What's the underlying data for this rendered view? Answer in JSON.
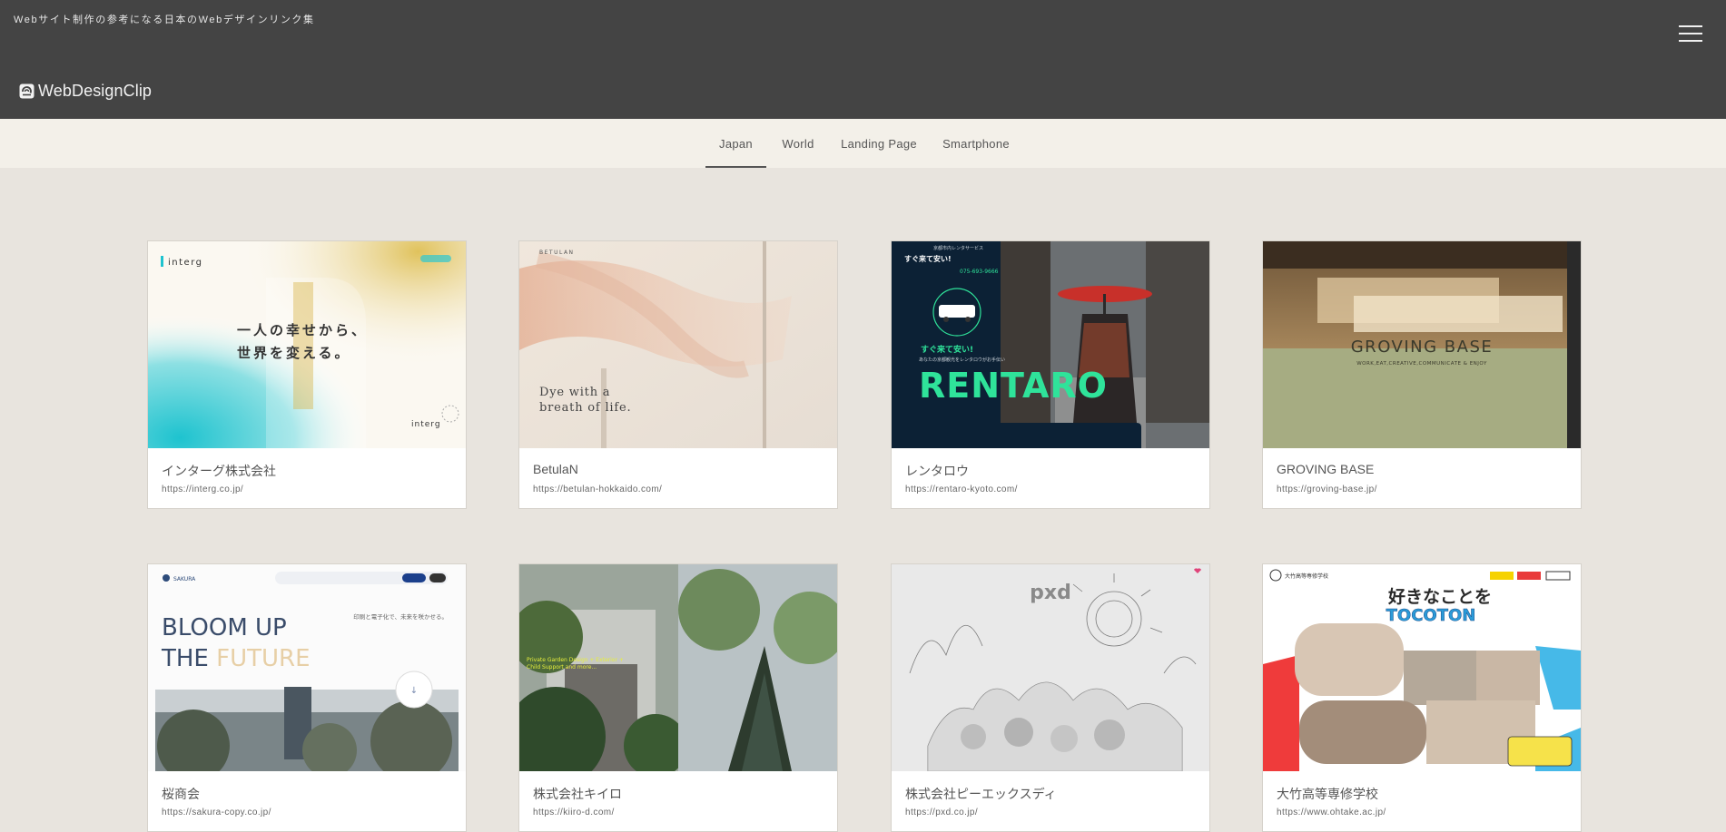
{
  "header": {
    "tagline": "Webサイト制作の参考になる日本のWebデザインリンク集",
    "logo_text": "WebDesignClip",
    "logo_icon": "wdc-logo-icon",
    "menu_icon": "hamburger-icon"
  },
  "nav": {
    "items": [
      {
        "label": "Japan",
        "active": true
      },
      {
        "label": "World",
        "active": false
      },
      {
        "label": "Landing Page",
        "active": false
      },
      {
        "label": "Smartphone",
        "active": false
      }
    ]
  },
  "cards": [
    {
      "title": "インターグ株式会社",
      "url": "https://interg.co.jp/",
      "thumb": {
        "headline1": "一人の幸せから、",
        "headline2": "世界を変える。",
        "brand": "interg"
      }
    },
    {
      "title": "BetulaN",
      "url": "https://betulan-hokkaido.com/",
      "thumb": {
        "line1": "Dye with a",
        "line2": "breath of life.",
        "brand": "BETULAN"
      }
    },
    {
      "title": "レンタロウ",
      "url": "https://rentaro-kyoto.com/",
      "thumb": {
        "catch": "すぐ来て安い!",
        "brand": "RENTARO",
        "phone": "075-693-9666"
      }
    },
    {
      "title": "GROVING BASE",
      "url": "https://groving-base.jp/",
      "thumb": {
        "brand": "GROVING BASE",
        "sub": "WORK,EAT,CREATIVE,COMMUNICATE & ENJOY"
      }
    },
    {
      "title": "桜商会",
      "url": "https://sakura-copy.co.jp/",
      "thumb": {
        "brand": "SAKURA",
        "line1": "BLOOM UP",
        "line2a": "THE ",
        "line2b": "FUTURE",
        "jp": "印刷と電子化で、未来を咲かせる。"
      }
    },
    {
      "title": "株式会社キイロ",
      "url": "https://kiiro-d.com/",
      "thumb": {
        "copy": "Private Garden Design + Exterior + Child Support and more..."
      }
    },
    {
      "title": "株式会社ピーエックスディ",
      "url": "https://pxd.co.jp/",
      "thumb": {
        "brand": "pxd"
      }
    },
    {
      "title": "大竹高等専修学校",
      "url": "https://www.ohtake.ac.jp/",
      "thumb": {
        "catch": "好きなことを",
        "brand": "TOCOTON",
        "school": "大竹高等専修学校"
      }
    }
  ],
  "colors": {
    "header_bg": "#444444",
    "nav_bg": "#f3f0e9",
    "page_bg": "#e8e4de",
    "rentaro_green": "#2fe39a"
  }
}
